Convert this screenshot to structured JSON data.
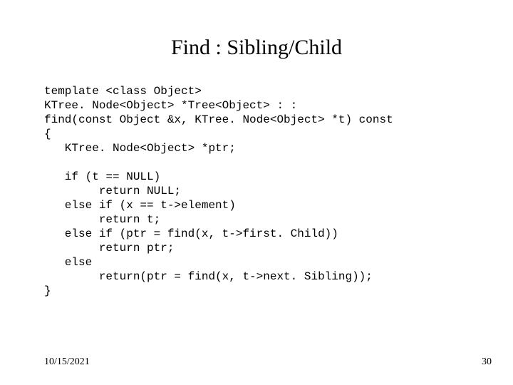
{
  "slide": {
    "title": "Find : Sibling/Child",
    "code": "template <class Object>\nKTree. Node<Object> *Tree<Object> : :\nfind(const Object &x, KTree. Node<Object> *t) const\n{\n   KTree. Node<Object> *ptr;\n\n   if (t == NULL)\n        return NULL;\n   else if (x == t->element)\n        return t;\n   else if (ptr = find(x, t->first. Child))\n        return ptr;\n   else\n        return(ptr = find(x, t->next. Sibling));\n}",
    "footer": {
      "date": "10/15/2021",
      "page": "30"
    }
  }
}
